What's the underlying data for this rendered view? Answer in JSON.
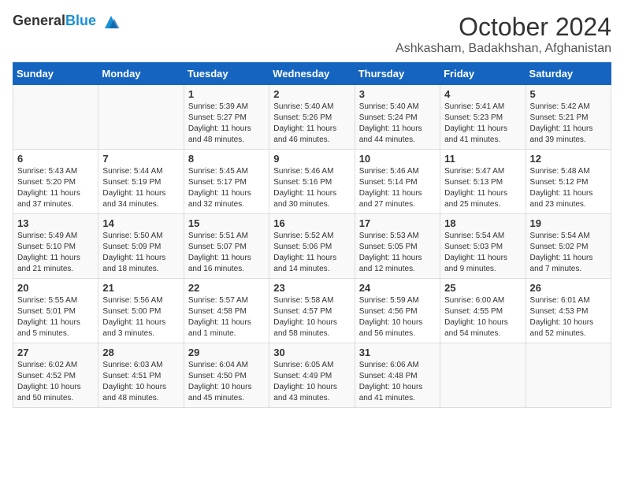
{
  "header": {
    "logo": {
      "general": "General",
      "blue": "Blue"
    },
    "month": "October 2024",
    "location": "Ashkasham, Badakhshan, Afghanistan"
  },
  "weekdays": [
    "Sunday",
    "Monday",
    "Tuesday",
    "Wednesday",
    "Thursday",
    "Friday",
    "Saturday"
  ],
  "weeks": [
    [
      {
        "day": "",
        "sunrise": "",
        "sunset": "",
        "daylight": ""
      },
      {
        "day": "",
        "sunrise": "",
        "sunset": "",
        "daylight": ""
      },
      {
        "day": "1",
        "sunrise": "Sunrise: 5:39 AM",
        "sunset": "Sunset: 5:27 PM",
        "daylight": "Daylight: 11 hours and 48 minutes."
      },
      {
        "day": "2",
        "sunrise": "Sunrise: 5:40 AM",
        "sunset": "Sunset: 5:26 PM",
        "daylight": "Daylight: 11 hours and 46 minutes."
      },
      {
        "day": "3",
        "sunrise": "Sunrise: 5:40 AM",
        "sunset": "Sunset: 5:24 PM",
        "daylight": "Daylight: 11 hours and 44 minutes."
      },
      {
        "day": "4",
        "sunrise": "Sunrise: 5:41 AM",
        "sunset": "Sunset: 5:23 PM",
        "daylight": "Daylight: 11 hours and 41 minutes."
      },
      {
        "day": "5",
        "sunrise": "Sunrise: 5:42 AM",
        "sunset": "Sunset: 5:21 PM",
        "daylight": "Daylight: 11 hours and 39 minutes."
      }
    ],
    [
      {
        "day": "6",
        "sunrise": "Sunrise: 5:43 AM",
        "sunset": "Sunset: 5:20 PM",
        "daylight": "Daylight: 11 hours and 37 minutes."
      },
      {
        "day": "7",
        "sunrise": "Sunrise: 5:44 AM",
        "sunset": "Sunset: 5:19 PM",
        "daylight": "Daylight: 11 hours and 34 minutes."
      },
      {
        "day": "8",
        "sunrise": "Sunrise: 5:45 AM",
        "sunset": "Sunset: 5:17 PM",
        "daylight": "Daylight: 11 hours and 32 minutes."
      },
      {
        "day": "9",
        "sunrise": "Sunrise: 5:46 AM",
        "sunset": "Sunset: 5:16 PM",
        "daylight": "Daylight: 11 hours and 30 minutes."
      },
      {
        "day": "10",
        "sunrise": "Sunrise: 5:46 AM",
        "sunset": "Sunset: 5:14 PM",
        "daylight": "Daylight: 11 hours and 27 minutes."
      },
      {
        "day": "11",
        "sunrise": "Sunrise: 5:47 AM",
        "sunset": "Sunset: 5:13 PM",
        "daylight": "Daylight: 11 hours and 25 minutes."
      },
      {
        "day": "12",
        "sunrise": "Sunrise: 5:48 AM",
        "sunset": "Sunset: 5:12 PM",
        "daylight": "Daylight: 11 hours and 23 minutes."
      }
    ],
    [
      {
        "day": "13",
        "sunrise": "Sunrise: 5:49 AM",
        "sunset": "Sunset: 5:10 PM",
        "daylight": "Daylight: 11 hours and 21 minutes."
      },
      {
        "day": "14",
        "sunrise": "Sunrise: 5:50 AM",
        "sunset": "Sunset: 5:09 PM",
        "daylight": "Daylight: 11 hours and 18 minutes."
      },
      {
        "day": "15",
        "sunrise": "Sunrise: 5:51 AM",
        "sunset": "Sunset: 5:07 PM",
        "daylight": "Daylight: 11 hours and 16 minutes."
      },
      {
        "day": "16",
        "sunrise": "Sunrise: 5:52 AM",
        "sunset": "Sunset: 5:06 PM",
        "daylight": "Daylight: 11 hours and 14 minutes."
      },
      {
        "day": "17",
        "sunrise": "Sunrise: 5:53 AM",
        "sunset": "Sunset: 5:05 PM",
        "daylight": "Daylight: 11 hours and 12 minutes."
      },
      {
        "day": "18",
        "sunrise": "Sunrise: 5:54 AM",
        "sunset": "Sunset: 5:03 PM",
        "daylight": "Daylight: 11 hours and 9 minutes."
      },
      {
        "day": "19",
        "sunrise": "Sunrise: 5:54 AM",
        "sunset": "Sunset: 5:02 PM",
        "daylight": "Daylight: 11 hours and 7 minutes."
      }
    ],
    [
      {
        "day": "20",
        "sunrise": "Sunrise: 5:55 AM",
        "sunset": "Sunset: 5:01 PM",
        "daylight": "Daylight: 11 hours and 5 minutes."
      },
      {
        "day": "21",
        "sunrise": "Sunrise: 5:56 AM",
        "sunset": "Sunset: 5:00 PM",
        "daylight": "Daylight: 11 hours and 3 minutes."
      },
      {
        "day": "22",
        "sunrise": "Sunrise: 5:57 AM",
        "sunset": "Sunset: 4:58 PM",
        "daylight": "Daylight: 11 hours and 1 minute."
      },
      {
        "day": "23",
        "sunrise": "Sunrise: 5:58 AM",
        "sunset": "Sunset: 4:57 PM",
        "daylight": "Daylight: 10 hours and 58 minutes."
      },
      {
        "day": "24",
        "sunrise": "Sunrise: 5:59 AM",
        "sunset": "Sunset: 4:56 PM",
        "daylight": "Daylight: 10 hours and 56 minutes."
      },
      {
        "day": "25",
        "sunrise": "Sunrise: 6:00 AM",
        "sunset": "Sunset: 4:55 PM",
        "daylight": "Daylight: 10 hours and 54 minutes."
      },
      {
        "day": "26",
        "sunrise": "Sunrise: 6:01 AM",
        "sunset": "Sunset: 4:53 PM",
        "daylight": "Daylight: 10 hours and 52 minutes."
      }
    ],
    [
      {
        "day": "27",
        "sunrise": "Sunrise: 6:02 AM",
        "sunset": "Sunset: 4:52 PM",
        "daylight": "Daylight: 10 hours and 50 minutes."
      },
      {
        "day": "28",
        "sunrise": "Sunrise: 6:03 AM",
        "sunset": "Sunset: 4:51 PM",
        "daylight": "Daylight: 10 hours and 48 minutes."
      },
      {
        "day": "29",
        "sunrise": "Sunrise: 6:04 AM",
        "sunset": "Sunset: 4:50 PM",
        "daylight": "Daylight: 10 hours and 45 minutes."
      },
      {
        "day": "30",
        "sunrise": "Sunrise: 6:05 AM",
        "sunset": "Sunset: 4:49 PM",
        "daylight": "Daylight: 10 hours and 43 minutes."
      },
      {
        "day": "31",
        "sunrise": "Sunrise: 6:06 AM",
        "sunset": "Sunset: 4:48 PM",
        "daylight": "Daylight: 10 hours and 41 minutes."
      },
      {
        "day": "",
        "sunrise": "",
        "sunset": "",
        "daylight": ""
      },
      {
        "day": "",
        "sunrise": "",
        "sunset": "",
        "daylight": ""
      }
    ]
  ]
}
